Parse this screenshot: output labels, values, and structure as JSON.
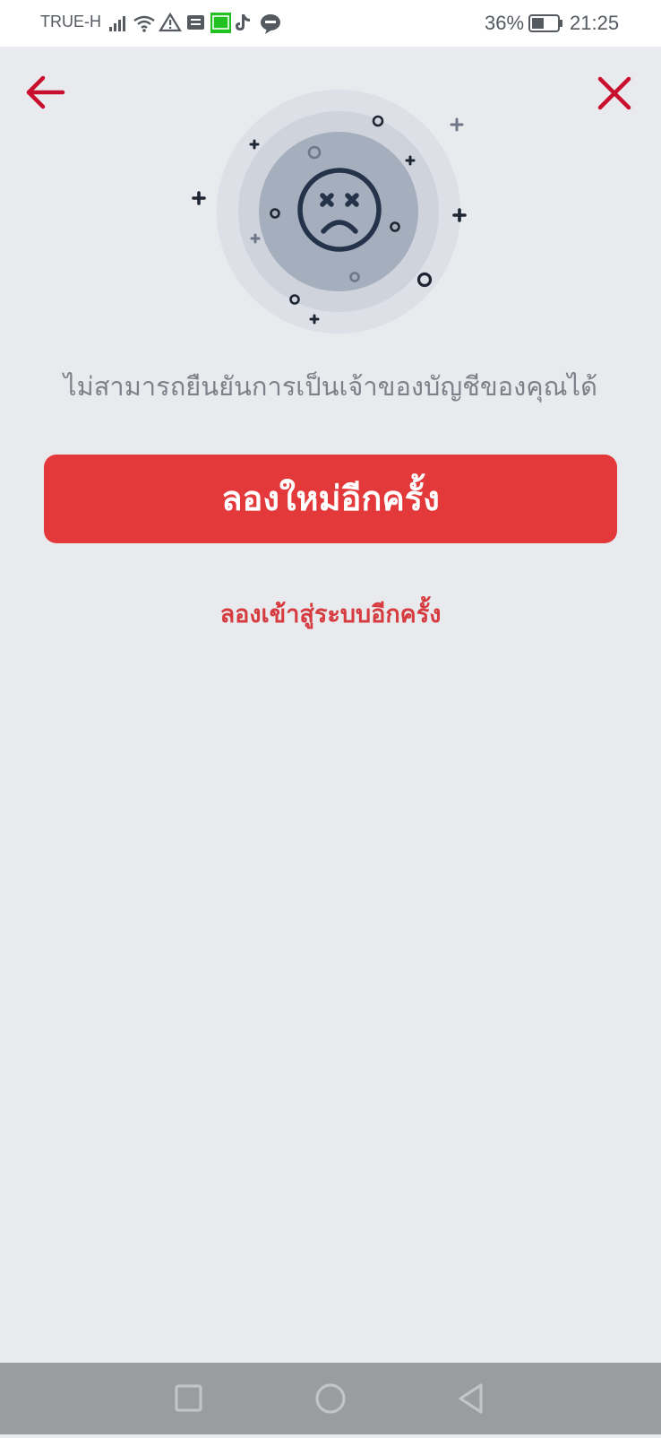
{
  "status_bar": {
    "carrier": "TRUE-H",
    "battery_percent": "36%",
    "time": "21:25"
  },
  "header": {
    "back_icon": "arrow-left-icon",
    "close_icon": "close-icon"
  },
  "illustration": {
    "icon": "sad-face-icon"
  },
  "message": {
    "text": "ไม่สามารถยืนยันการเป็นเจ้าของบัญชีของคุณได้"
  },
  "actions": {
    "retry_label": "ลองใหม่อีกครั้ง",
    "relogin_label": "ลองเข้าสู่ระบบอีกครั้ง"
  },
  "colors": {
    "accent": "#e3393b",
    "link": "#d63c3f",
    "background": "#e9eaed",
    "icon_red": "#c8102e"
  },
  "nav_bar": {
    "recent_icon": "square-icon",
    "home_icon": "circle-icon",
    "back_icon": "triangle-back-icon"
  }
}
